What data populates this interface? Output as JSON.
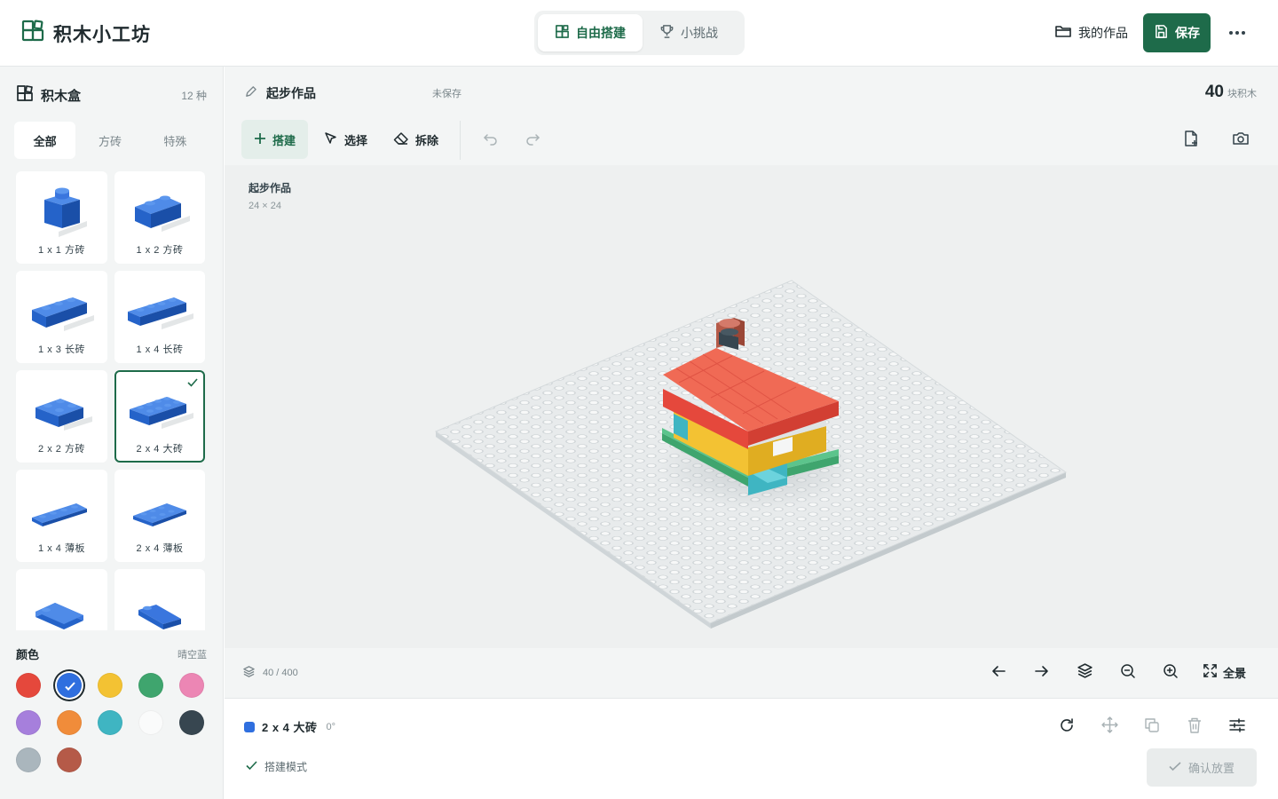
{
  "app": {
    "title": "积木小工坊"
  },
  "modes": [
    {
      "label": "自由搭建",
      "icon": "blocks-icon",
      "active": true
    },
    {
      "label": "小挑战",
      "icon": "trophy-icon",
      "active": false
    }
  ],
  "header": {
    "my_works_label": "我的作品",
    "save_label": "保存",
    "more_icon": "more-icon"
  },
  "sidebar": {
    "title": "积木盒",
    "count": "12 种",
    "tabs": [
      {
        "label": "全部",
        "active": true
      },
      {
        "label": "方砖",
        "active": false
      },
      {
        "label": "特殊",
        "active": false
      }
    ],
    "bricks": [
      {
        "label": "1 x 1 方砖",
        "selected": false
      },
      {
        "label": "1 x 2 方砖",
        "selected": false
      },
      {
        "label": "1 x 3 长砖",
        "selected": false
      },
      {
        "label": "1 x 4 长砖",
        "selected": false
      },
      {
        "label": "2 x 2 方砖",
        "selected": false
      },
      {
        "label": "2 x 4 大砖",
        "selected": true
      },
      {
        "label": "1 x 4 薄板",
        "selected": false
      },
      {
        "label": "2 x 4 薄板",
        "selected": false
      },
      {
        "label": "",
        "selected": false
      },
      {
        "label": "",
        "selected": false
      }
    ],
    "colors_title": "颜色",
    "current_color_name": "晴空蓝",
    "colors": [
      "#e5483c",
      "#2f6fdf",
      "#f3c233",
      "#3fa56e",
      "#ec86b4",
      "#a67fdc",
      "#f08c3a",
      "#3fb5c2",
      "#fafbfb",
      "#374650",
      "#aab6bd",
      "#b55a48"
    ],
    "selected_color_index": 1
  },
  "workspace": {
    "name": "起步作品",
    "save_status": "未保存",
    "brick_total": "40",
    "brick_total_unit": "块积木",
    "tools": [
      {
        "label": "搭建",
        "icon": "plus-icon",
        "active": true
      },
      {
        "label": "选择",
        "icon": "pointer-icon",
        "active": false
      },
      {
        "label": "拆除",
        "icon": "eraser-icon",
        "active": false
      }
    ],
    "canvas_label": "起步作品",
    "canvas_size": "24 × 24",
    "layer_count": "40 / 400",
    "fullscreen_label": "全景"
  },
  "status": {
    "selected_brick": "2 x 4 大砖",
    "rotation": "0°",
    "mode_note": "搭建模式",
    "confirm_label": "确认放置"
  }
}
